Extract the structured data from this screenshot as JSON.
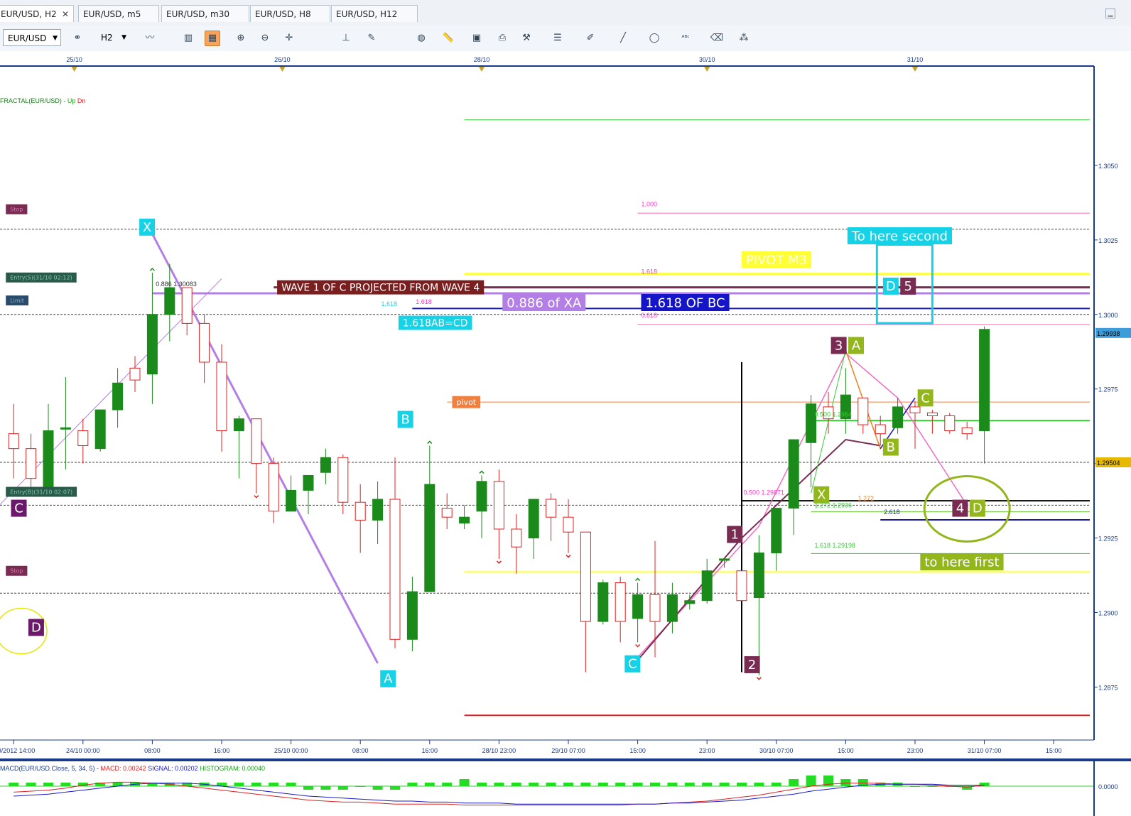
{
  "tabs": [
    {
      "label": "EUR/USD, H2",
      "active": true
    },
    {
      "label": "EUR/USD, m5"
    },
    {
      "label": "EUR/USD, m30"
    },
    {
      "label": "EUR/USD, H8"
    },
    {
      "label": "EUR/USD, H12"
    }
  ],
  "toolbar": {
    "symbol": "EUR/USD",
    "timeframe": "H2",
    "icons": [
      "link-icon",
      "line-chart-icon",
      "bar-chart-icon",
      "candle-chart-icon",
      "zoom-in-icon",
      "zoom-out-icon",
      "crosshair-icon",
      "period-separator-icon",
      "template-icon",
      "globe-icon",
      "ruler-icon",
      "screenshot-icon",
      "print-icon",
      "indicator-icon",
      "horizontal-line-icon",
      "pen-icon",
      "trend-line-icon",
      "ellipse-icon",
      "text-label-icon",
      "eraser-icon",
      "pattern-icon"
    ]
  },
  "colors": {
    "bull": "#1a8a1a",
    "bear": "#e02020",
    "pink": "#f06ec0",
    "purple": "#b37fe6",
    "cyan": "#16d2e6",
    "maroon": "#7a2b52",
    "olive": "#93b71b",
    "dark_purple": "#6b1a6b",
    "yellow": "#ffff33"
  },
  "chart_data": {
    "type": "candlestick",
    "indicator_label": "FRACTAL(EUR/USD) - ",
    "indicator_up": "Up",
    "indicator_dn": "Dn",
    "ylim": [
      1.2862,
      1.3075
    ],
    "y_ticks": [
      "1.3050",
      "1.3025",
      "1.3000",
      "1.2975",
      "1.2950",
      "1.2925",
      "1.2900",
      "1.2875"
    ],
    "price_badges": [
      {
        "label": "1.29938",
        "value": 1.29938,
        "color": "#3d9ddb"
      },
      {
        "label": "1.29504",
        "value": 1.29504,
        "color": "#e6b800"
      }
    ],
    "top_dates": [
      {
        "label": "25/10",
        "bar": 4
      },
      {
        "label": "26/10",
        "bar": 16
      },
      {
        "label": "28/10",
        "bar": 27.5
      },
      {
        "label": "30/10",
        "bar": 40.5
      },
      {
        "label": "31/10",
        "bar": 52.5
      }
    ],
    "bottom_ticks": [
      {
        "label": "/10/2012 14:00",
        "bar": 0.5
      },
      {
        "label": "24/10 00:00",
        "bar": 4.5
      },
      {
        "label": "08:00",
        "bar": 8.5
      },
      {
        "label": "16:00",
        "bar": 12.5
      },
      {
        "label": "25/10 00:00",
        "bar": 16.5
      },
      {
        "label": "08:00",
        "bar": 20.5
      },
      {
        "label": "16:00",
        "bar": 24.5
      },
      {
        "label": "28/10 23:00",
        "bar": 28.5
      },
      {
        "label": "29/10 07:00",
        "bar": 32.5
      },
      {
        "label": "15:00",
        "bar": 36.5
      },
      {
        "label": "23:00",
        "bar": 40.5
      },
      {
        "label": "30/10 07:00",
        "bar": 44.5
      },
      {
        "label": "15:00",
        "bar": 48.5
      },
      {
        "label": "23:00",
        "bar": 52.5
      },
      {
        "label": "31/10 07:00",
        "bar": 56.5
      },
      {
        "label": "15:00",
        "bar": 60.5
      }
    ],
    "candles": [
      [
        1.296,
        1.297,
        1.2945,
        1.2955
      ],
      [
        1.2955,
        1.296,
        1.294,
        1.2945
      ],
      [
        1.2942,
        1.297,
        1.2939,
        1.2961
      ],
      [
        1.2962,
        1.2979,
        1.2948,
        1.2962
      ],
      [
        1.2961,
        1.2965,
        1.295,
        1.2956
      ],
      [
        1.2955,
        1.2968,
        1.2954,
        1.2968
      ],
      [
        1.2968,
        1.2982,
        1.2962,
        1.2977
      ],
      [
        1.2982,
        1.2986,
        1.2974,
        1.2978
      ],
      [
        1.298,
        1.3014,
        1.297,
        1.3
      ],
      [
        1.3,
        1.3017,
        1.2991,
        1.3009
      ],
      [
        1.3009,
        1.3008,
        1.2993,
        1.2997
      ],
      [
        1.2997,
        1.3,
        1.2977,
        1.2984
      ],
      [
        1.2984,
        1.299,
        1.2954,
        1.2961
      ],
      [
        1.2961,
        1.2966,
        1.2945,
        1.2965
      ],
      [
        1.2965,
        1.2965,
        1.294,
        1.295
      ],
      [
        1.295,
        1.2952,
        1.293,
        1.2934
      ],
      [
        1.2934,
        1.2946,
        1.2934,
        1.2941
      ],
      [
        1.2941,
        1.2944,
        1.2933,
        1.2946
      ],
      [
        1.2947,
        1.2955,
        1.2943,
        1.2952
      ],
      [
        1.2952,
        1.2953,
        1.2933,
        1.2937
      ],
      [
        1.2937,
        1.2943,
        1.292,
        1.2931
      ],
      [
        1.2931,
        1.2944,
        1.2923,
        1.2938
      ],
      [
        1.2938,
        1.2952,
        1.2888,
        1.2891
      ],
      [
        1.2891,
        1.2912,
        1.2887,
        1.2907
      ],
      [
        1.2907,
        1.2956,
        1.2907,
        1.2943
      ],
      [
        1.2935,
        1.294,
        1.2928,
        1.2932
      ],
      [
        1.293,
        1.2936,
        1.2928,
        1.2932
      ],
      [
        1.2934,
        1.2946,
        1.2925,
        1.2944
      ],
      [
        1.2944,
        1.2948,
        1.2918,
        1.2928
      ],
      [
        1.2928,
        1.2933,
        1.2913,
        1.2922
      ],
      [
        1.2925,
        1.2938,
        1.2918,
        1.2938
      ],
      [
        1.2938,
        1.294,
        1.2924,
        1.2932
      ],
      [
        1.2932,
        1.2938,
        1.292,
        1.2927
      ],
      [
        1.2927,
        1.2914,
        1.288,
        1.2897
      ],
      [
        1.2897,
        1.2911,
        1.2896,
        1.291
      ],
      [
        1.291,
        1.2912,
        1.289,
        1.2897
      ],
      [
        1.2898,
        1.291,
        1.289,
        1.2906
      ],
      [
        1.2906,
        1.2924,
        1.2885,
        1.2897
      ],
      [
        1.2897,
        1.291,
        1.2893,
        1.2906
      ],
      [
        1.2903,
        1.2906,
        1.2901,
        1.2904
      ],
      [
        1.2904,
        1.2918,
        1.2903,
        1.2914
      ],
      [
        1.2918,
        1.2918,
        1.2915,
        1.2918
      ],
      [
        1.2914,
        1.2914,
        1.2904,
        1.2904
      ],
      [
        1.2905,
        1.2926,
        1.2879,
        1.292
      ],
      [
        1.292,
        1.2935,
        1.2914,
        1.2935
      ],
      [
        1.2935,
        1.2955,
        1.2926,
        1.2958
      ],
      [
        1.2957,
        1.2973,
        1.2942,
        1.297
      ],
      [
        1.2969,
        1.2974,
        1.296,
        1.2965
      ],
      [
        1.2965,
        1.2982,
        1.296,
        1.2973
      ],
      [
        1.2972,
        1.2972,
        1.296,
        1.2963
      ],
      [
        1.2963,
        1.2966,
        1.2956,
        1.296
      ],
      [
        1.2962,
        1.2972,
        1.296,
        1.2969
      ],
      [
        1.2969,
        1.2971,
        1.2955,
        1.2967
      ],
      [
        1.2967,
        1.2968,
        1.296,
        1.2966
      ],
      [
        1.2966,
        1.2967,
        1.296,
        1.2961
      ],
      [
        1.2962,
        1.2964,
        1.2958,
        1.296
      ],
      [
        1.2961,
        1.2996,
        1.295,
        1.2995
      ]
    ],
    "fractal_up": [
      8,
      24,
      27,
      36
    ],
    "fractal_dn": [
      14,
      28,
      32,
      36,
      43
    ],
    "hlines": [
      {
        "y": 1.30653,
        "color": "#33cc33",
        "x0": 26.5,
        "w": 1
      },
      {
        "y": 1.3034,
        "color": "#ff66b3",
        "x0": 36.5,
        "w": 1
      },
      {
        "y": 1.30286,
        "color": "#444",
        "x0": -1,
        "w": 1,
        "dash": true
      },
      {
        "y": 1.30136,
        "color": "#ffff33",
        "x0": 26.5,
        "w": 3
      },
      {
        "y": 1.30091,
        "color": "#7a2b52",
        "x0": 15.5,
        "w": 3
      },
      {
        "y": 1.30071,
        "color": "#b37fe6",
        "x0": 8.5,
        "w": 3
      },
      {
        "y": 1.3002,
        "color": "#1a1aa0",
        "x0": 23.5,
        "w": 2
      },
      {
        "y": 1.3,
        "color": "#444",
        "x0": -1,
        "w": 1,
        "dash": true
      },
      {
        "y": 1.29966,
        "color": "#ff66b3",
        "x0": 36.5,
        "w": 1
      },
      {
        "y": 1.29706,
        "color": "#f08040",
        "x0": 25.5,
        "w": 1
      },
      {
        "y": 1.29644,
        "color": "#33cc33",
        "x0": 46.5,
        "w": 2
      },
      {
        "y": 1.29504,
        "color": "#444",
        "x0": -1,
        "w": 1,
        "dash": true
      },
      {
        "y": 1.29375,
        "color": "#000000",
        "x0": 42.5,
        "w": 2
      },
      {
        "y": 1.2936,
        "color": "#444",
        "x0": -1,
        "w": 1,
        "dash": true
      },
      {
        "y": 1.29338,
        "color": "#66cc33",
        "x0": 46.5,
        "w": 1
      },
      {
        "y": 1.29311,
        "color": "#1a1aa0",
        "x0": 50.5,
        "w": 2
      },
      {
        "y": 1.29198,
        "color": "#33cc33",
        "x0": 46.5,
        "w": 1
      },
      {
        "y": 1.29136,
        "color": "#ffff33",
        "x0": 26.5,
        "w": 2
      },
      {
        "y": 1.29065,
        "color": "#444",
        "x0": -1,
        "w": 1,
        "dash": true
      },
      {
        "y": 1.28655,
        "color": "#e02020",
        "x0": 26.5,
        "w": 2
      }
    ],
    "plines": [
      {
        "pts": [
          [
            8.5,
            1.3027
          ],
          [
            21.5,
            1.2883
          ]
        ],
        "color": "#b37fe6",
        "w": 3
      },
      {
        "pts": [
          [
            -1,
            1.2932
          ],
          [
            12.5,
            1.3012
          ]
        ],
        "color": "#b37fe6",
        "w": 1
      },
      {
        "pts": [
          [
            36.5,
            1.2885
          ],
          [
            43.5,
            1.2929
          ],
          [
            48.5,
            1.2987
          ],
          [
            51.5,
            1.2972
          ],
          [
            55.5,
            1.2936
          ]
        ],
        "color": "#f06ec0",
        "w": 1.5
      },
      {
        "pts": [
          [
            36.5,
            1.2884
          ],
          [
            42.5,
            1.2925
          ],
          [
            48.5,
            1.2958
          ],
          [
            50.5,
            1.2956
          ]
        ],
        "color": "#7a2b52",
        "w": 2
      },
      {
        "pts": [
          [
            46.5,
            1.294
          ],
          [
            48.5,
            1.2988
          ],
          [
            50.5,
            1.2955
          ],
          [
            52.5,
            1.2972
          ]
        ],
        "color": "#33cc33",
        "w": 1
      },
      {
        "pts": [
          [
            48.5,
            1.2988
          ],
          [
            50.5,
            1.2955
          ],
          [
            52.5,
            1.2972
          ]
        ],
        "color": "#f08020",
        "w": 1.5
      },
      {
        "pts": [
          [
            50.5,
            1.2955
          ],
          [
            52.5,
            1.2972
          ]
        ],
        "color": "#1a1ad0",
        "w": 1.5
      }
    ],
    "vline": {
      "bar": 42.5,
      "y0": 1.2984,
      "y1": 1.288
    },
    "markers": [
      {
        "t": "X",
        "bar": 8.2,
        "y": 1.30293,
        "color": "#16d2e6"
      },
      {
        "t": "A",
        "bar": 22.1,
        "y": 1.28778,
        "color": "#16d2e6"
      },
      {
        "t": "B",
        "bar": 23.1,
        "y": 1.29648,
        "color": "#16d2e6"
      },
      {
        "t": "C",
        "bar": 36.2,
        "y": 1.28828,
        "color": "#16d2e6"
      },
      {
        "t": "D",
        "bar": 51.1,
        "y": 1.30095,
        "color": "#16d2e6"
      },
      {
        "t": "1",
        "bar": 42.1,
        "y": 1.29262,
        "color": "#7a2b52"
      },
      {
        "t": "2",
        "bar": 43.1,
        "y": 1.28825,
        "color": "#7a2b52"
      },
      {
        "t": "3",
        "bar": 48.1,
        "y": 1.29896,
        "color": "#7a2b52"
      },
      {
        "t": "4",
        "bar": 55.1,
        "y": 1.2935,
        "color": "#7a2b52"
      },
      {
        "t": "5",
        "bar": 52.1,
        "y": 1.30095,
        "color": "#7a2b52"
      },
      {
        "t": "A",
        "bar": 49.1,
        "y": 1.29896,
        "color": "#93b71b"
      },
      {
        "t": "B",
        "bar": 51.1,
        "y": 1.29555,
        "color": "#93b71b"
      },
      {
        "t": "C",
        "bar": 53.1,
        "y": 1.2972,
        "color": "#93b71b"
      },
      {
        "t": "X",
        "bar": 47.1,
        "y": 1.29395,
        "color": "#93b71b"
      },
      {
        "t": "D",
        "bar": 56.1,
        "y": 1.2935,
        "color": "#93b71b"
      },
      {
        "t": "C",
        "bar": 0.8,
        "y": 1.2935,
        "color": "#6b1a6b"
      },
      {
        "t": "D",
        "bar": 1.8,
        "y": 1.2895,
        "color": "#6b1a6b"
      }
    ],
    "labels": [
      {
        "t": "WAVE 1 OF C PROJECTED FROM WAVE 4",
        "bar": 15.7,
        "y": 1.30091,
        "bg": "#7a1f1f",
        "fg": "#ffffff",
        "fs": 14
      },
      {
        "t": "0.886 of XA",
        "bar": 28.7,
        "y": 1.3004,
        "bg": "#b37fe6",
        "fg": "#ffffff",
        "fs": 18
      },
      {
        "t": "1.618 OF BC",
        "bar": 36.7,
        "y": 1.3004,
        "bg": "#1414c8",
        "fg": "#ffffff",
        "fs": 18
      },
      {
        "t": "1.618AB=CD",
        "bar": 22.7,
        "y": 1.29972,
        "bg": "#16d2e6",
        "fg": "#ffffff",
        "fs": 14
      },
      {
        "t": "PIVOT M3",
        "bar": 42.5,
        "y": 1.30184,
        "bg": "#ffff33",
        "fg": "#ffffff",
        "fs": 18
      },
      {
        "t": "To here second",
        "bar": 48.6,
        "y": 1.30264,
        "bg": "#16d2e6",
        "fg": "#ffffff",
        "fs": 18
      },
      {
        "t": "to here first",
        "bar": 52.8,
        "y": 1.2917,
        "bg": "#93b71b",
        "fg": "#ffffff",
        "fs": 18
      },
      {
        "t": "pivot",
        "bar": 25.8,
        "y": 1.29706,
        "bg": "#f08040",
        "fg": "#ffffff",
        "fs": 11
      },
      {
        "t": "Stop",
        "bar": 0.05,
        "y": 1.30353,
        "bg": "#7a2b52",
        "fg": "#d07ab0",
        "fs": 8
      },
      {
        "t": "Entry(S)(31/10 02:12)",
        "bar": 0.05,
        "y": 1.30124,
        "bg": "#2a5b4a",
        "fg": "#7fc7b0",
        "fs": 8
      },
      {
        "t": "Limit",
        "bar": 0.05,
        "y": 1.30047,
        "bg": "#2a4b6a",
        "fg": "#7fb0d0",
        "fs": 8
      },
      {
        "t": "Entry(B)(31/10 02:07)",
        "bar": 0.05,
        "y": 1.29405,
        "bg": "#2a5b4a",
        "fg": "#7fc7b0",
        "fs": 8
      },
      {
        "t": "Stop",
        "bar": 0.05,
        "y": 1.2914,
        "bg": "#7a2b52",
        "fg": "#d07ab0",
        "fs": 8
      }
    ],
    "fib_labels": [
      {
        "t": "1.000",
        "bar": 36.7,
        "y": 1.30363,
        "c": "#ff33cc"
      },
      {
        "t": "1.618",
        "bar": 36.7,
        "y": 1.30137,
        "c": "#ff33cc"
      },
      {
        "t": "0.618",
        "bar": 36.7,
        "y": 1.2999,
        "c": "#ff33cc"
      },
      {
        "t": "1.618",
        "bar": 21.7,
        "y": 1.30028,
        "c": "#16d2e6"
      },
      {
        "t": "1.618",
        "bar": 23.7,
        "y": 1.30035,
        "c": "#ff33cc"
      },
      {
        "t": "0.886 1.30083",
        "bar": 8.7,
        "y": 1.30095,
        "c": "#333333"
      },
      {
        "t": "0.500 1.29871",
        "bar": 42.6,
        "y": 1.29395,
        "c": "#ff33cc"
      },
      {
        "t": "0.500 1.2964",
        "bar": 46.7,
        "y": 1.29658,
        "c": "#33cc33"
      },
      {
        "t": "1.272 1.2936",
        "bar": 46.7,
        "y": 1.29353,
        "c": "#33cc33"
      },
      {
        "t": "1.272",
        "bar": 49.2,
        "y": 1.29375,
        "c": "#f08020"
      },
      {
        "t": "2.618",
        "bar": 50.7,
        "y": 1.2933,
        "c": "#1a1aa0"
      },
      {
        "t": "1.618 1.29198",
        "bar": 46.7,
        "y": 1.29218,
        "c": "#33cc33"
      }
    ],
    "macd": {
      "label": "MACD(EUR/USD.Close, 5, 34, 5) - ",
      "macd_label": "MACD: 0.00242",
      "signal_label": "SIGNAL: 0.00202",
      "hist_label": "HISTOGRAM: 0.00040",
      "axis_label": "0.0000",
      "hist": [
        1,
        1,
        1,
        1,
        1,
        1,
        1,
        1,
        1,
        1,
        1,
        1,
        1,
        1,
        1,
        1,
        1,
        -1,
        -1,
        -1,
        0,
        -1,
        -1,
        1,
        1,
        1,
        2,
        1,
        1,
        1,
        1,
        1,
        1,
        1,
        1,
        1,
        1,
        1,
        1,
        1,
        1,
        1,
        1,
        1,
        1,
        2,
        3,
        3,
        2,
        2,
        1,
        1,
        0,
        0,
        0,
        -1,
        1
      ],
      "macd_line": [
        -6,
        -5,
        -4,
        -2,
        1,
        3,
        4,
        4,
        3,
        2,
        0,
        -2,
        -4,
        -6,
        -8,
        -10,
        -12,
        -14,
        -15,
        -16,
        -16,
        -17,
        -18,
        -18,
        -18,
        -18,
        -19,
        -19,
        -19,
        -19,
        -19,
        -19,
        -19,
        -19,
        -19,
        -19,
        -18,
        -18,
        -17,
        -16,
        -15,
        -13,
        -11,
        -9,
        -6,
        -3,
        0,
        2,
        3,
        3,
        3,
        2,
        2,
        1,
        0,
        -1,
        1
      ],
      "signal_line": [
        -10,
        -9,
        -8,
        -6,
        -4,
        -2,
        0,
        2,
        3,
        3,
        3,
        2,
        0,
        -2,
        -4,
        -6,
        -8,
        -10,
        -11,
        -12,
        -13,
        -14,
        -15,
        -15,
        -16,
        -16,
        -17,
        -17,
        -17,
        -18,
        -18,
        -18,
        -18,
        -18,
        -18,
        -18,
        -18,
        -18,
        -17,
        -17,
        -16,
        -15,
        -14,
        -12,
        -10,
        -8,
        -5,
        -3,
        -1,
        1,
        2,
        2,
        2,
        2,
        1,
        1,
        1
      ]
    }
  }
}
